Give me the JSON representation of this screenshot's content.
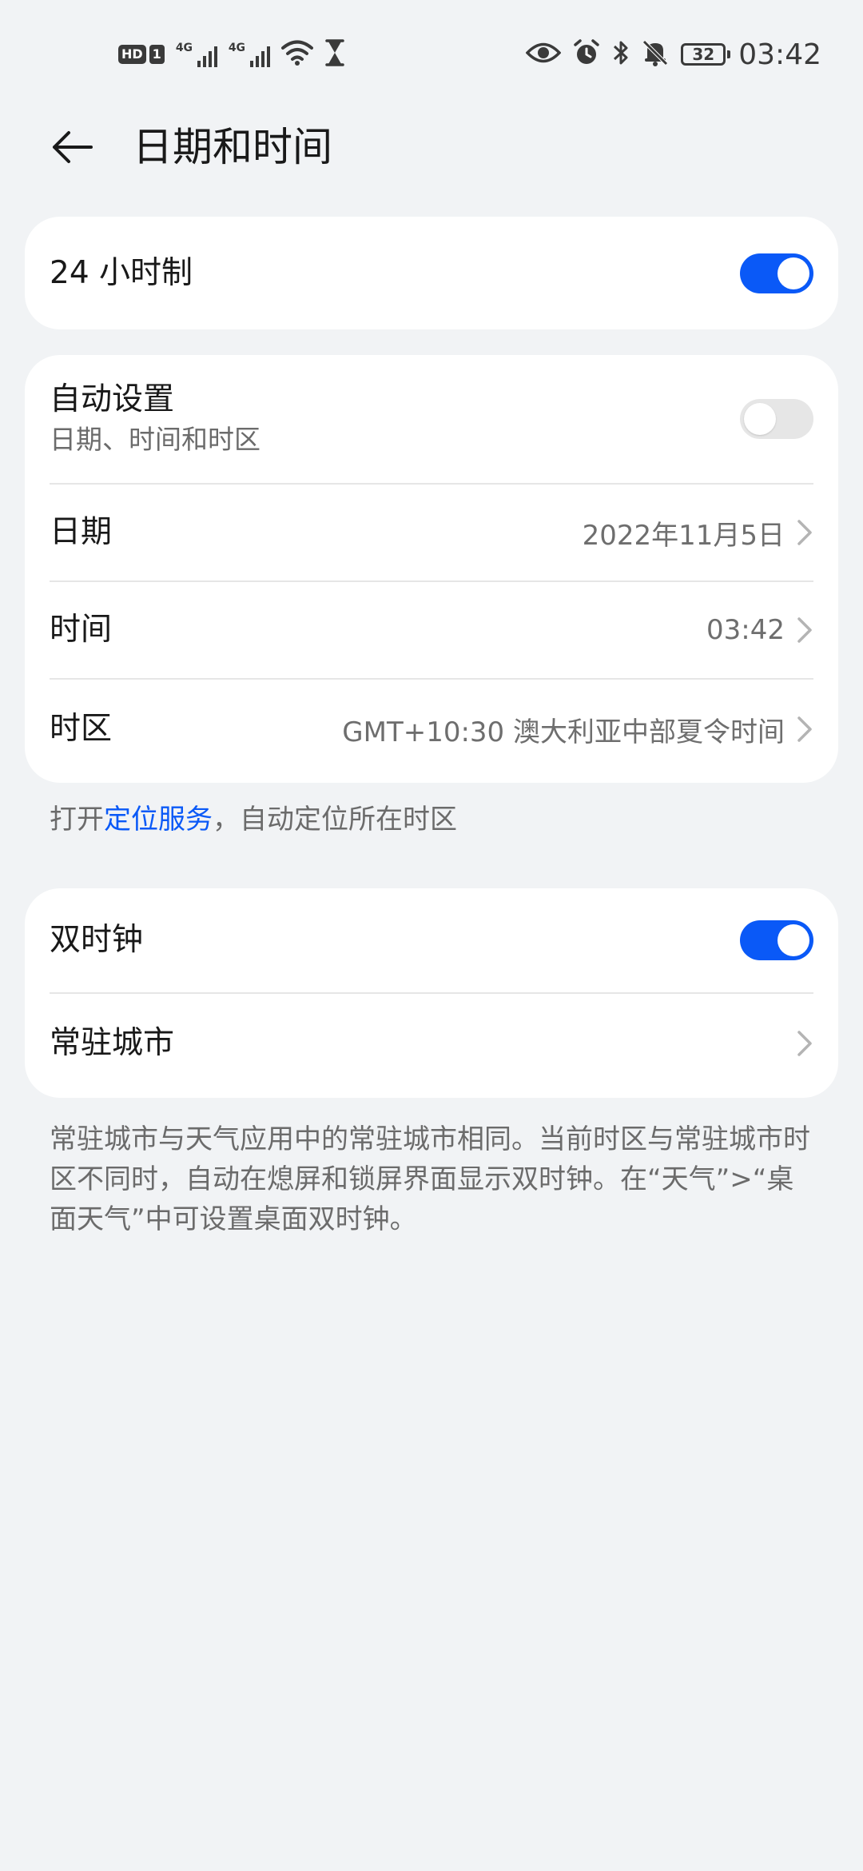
{
  "status_bar": {
    "hd_label": "HD",
    "sim_label": "1",
    "network1": "4G",
    "network2": "4G",
    "battery_level": "32",
    "time": "03:42",
    "icons": [
      "eye-icon",
      "alarm-icon",
      "bluetooth-icon",
      "mute-icon"
    ]
  },
  "header": {
    "title": "日期和时间"
  },
  "card_24h": {
    "label": "24 小时制",
    "toggle_on": true
  },
  "card_auto": {
    "auto_title": "自动设置",
    "auto_subtitle": "日期、时间和时区",
    "auto_on": false,
    "date_label": "日期",
    "date_value": "2022年11月5日",
    "time_label": "时间",
    "time_value": "03:42",
    "timezone_label": "时区",
    "timezone_value": "GMT+10:30 澳大利亚中部夏令时间"
  },
  "location_note": {
    "prefix": "打开",
    "link": "定位服务",
    "suffix": "，自动定位所在时区"
  },
  "card_dual": {
    "dual_label": "双时钟",
    "dual_on": true,
    "city_label": "常驻城市"
  },
  "dual_note": "常驻城市与天气应用中的常驻城市相同。当前时区与常驻城市时区不同时，自动在熄屏和锁屏界面显示双时钟。在“天气”>“桌面天气”中可设置桌面双时钟。",
  "colors": {
    "accent": "#0a59f7",
    "background": "#f1f3f5",
    "card": "#ffffff"
  }
}
